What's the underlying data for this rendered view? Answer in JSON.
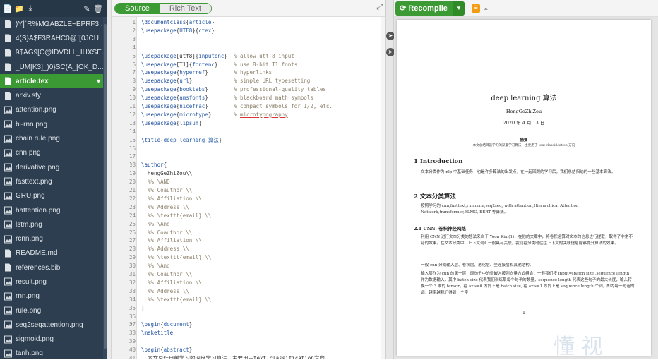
{
  "sidebar": {
    "files": [
      {
        "name": ")Y]`R%MGABZLE~EPRF3..."
      },
      {
        "name": "4(S}A$F3RAHC0@`[0JCU..."
      },
      {
        "name": "9$AG9[C@IDVDLL_IHXSE..."
      },
      {
        "name": "_UM[K3]_)0}SC(A_[OK_D..."
      },
      {
        "name": "article.tex",
        "active": true
      },
      {
        "name": "arxiv.sty"
      },
      {
        "name": "attention.png"
      },
      {
        "name": "bi-rnn.png"
      },
      {
        "name": "chain rule.png"
      },
      {
        "name": "cnn.png"
      },
      {
        "name": "derivative.png"
      },
      {
        "name": "fasttext.png"
      },
      {
        "name": "GRU.png"
      },
      {
        "name": "hattention.png"
      },
      {
        "name": "lstm.png"
      },
      {
        "name": "rcnn.png"
      },
      {
        "name": "README.md"
      },
      {
        "name": "references.bib"
      },
      {
        "name": "result.png"
      },
      {
        "name": "rnn.png"
      },
      {
        "name": "rule.png"
      },
      {
        "name": "seq2seqattention.png"
      },
      {
        "name": "sigmoid.png"
      },
      {
        "name": "tanh.png"
      }
    ]
  },
  "editor": {
    "toggle_source": "Source",
    "toggle_rich": "Rich Text",
    "lines": [
      {
        "n": "1",
        "t": "\\documentclass{article}"
      },
      {
        "n": "2",
        "t": "\\usepackage{UTF8}{ctex}"
      },
      {
        "n": "3",
        "t": ""
      },
      {
        "n": "4",
        "t": ""
      },
      {
        "n": "5",
        "t": "\\usepackage[utf8]{inputenc}  % allow utf-8 input"
      },
      {
        "n": "6",
        "t": "\\usepackage[T1]{fontenc}     % use 8-bit T1 fonts"
      },
      {
        "n": "7",
        "t": "\\usepackage{hyperref}        % hyperlinks"
      },
      {
        "n": "8",
        "t": "\\usepackage{url}             % simple URL typesetting"
      },
      {
        "n": "9",
        "t": "\\usepackage{booktabs}        % professional-quality tables"
      },
      {
        "n": "10",
        "t": "\\usepackage{amsfonts}        % blackboard math symbols"
      },
      {
        "n": "11",
        "t": "\\usepackage{nicefrac}        % compact symbols for 1/2, etc."
      },
      {
        "n": "12",
        "t": "\\usepackage{microtype}       % microtypography"
      },
      {
        "n": "13",
        "t": "\\usepackage{lipsum}"
      },
      {
        "n": "14",
        "t": ""
      },
      {
        "n": "15",
        "t": "\\title{deep learning 算法}"
      },
      {
        "n": "16",
        "t": ""
      },
      {
        "n": "17",
        "t": ""
      },
      {
        "n": "18",
        "t": "\\author{",
        "fold": true
      },
      {
        "n": "19",
        "t": "  HengGeZhiZou\\\\"
      },
      {
        "n": "20",
        "t": "  %% \\AND"
      },
      {
        "n": "21",
        "t": "  %% Coauthor \\\\"
      },
      {
        "n": "22",
        "t": "  %% Affiliation \\\\"
      },
      {
        "n": "23",
        "t": "  %% Address \\\\"
      },
      {
        "n": "24",
        "t": "  %% \\texttt{email} \\\\"
      },
      {
        "n": "25",
        "t": "  %% \\And"
      },
      {
        "n": "26",
        "t": "  %% Coauthor \\\\"
      },
      {
        "n": "27",
        "t": "  %% Affiliation \\\\"
      },
      {
        "n": "28",
        "t": "  %% Address \\\\"
      },
      {
        "n": "29",
        "t": "  %% \\texttt{email} \\\\"
      },
      {
        "n": "30",
        "t": "  %% \\And"
      },
      {
        "n": "31",
        "t": "  %% Coauthor \\\\"
      },
      {
        "n": "32",
        "t": "  %% Affiliation \\\\"
      },
      {
        "n": "33",
        "t": "  %% Address \\\\"
      },
      {
        "n": "34",
        "t": "  %% \\texttt{email} \\\\"
      },
      {
        "n": "35",
        "t": "}"
      },
      {
        "n": "36",
        "t": ""
      },
      {
        "n": "37",
        "t": "\\begin{document}",
        "fold": true
      },
      {
        "n": "38",
        "t": "\\maketitle"
      },
      {
        "n": "39",
        "t": ""
      },
      {
        "n": "40",
        "t": "\\begin{abstract}",
        "fold": true
      },
      {
        "n": "41",
        "t": "  本文总结目前学习的深度学习算法，主要用于text classification方向"
      }
    ]
  },
  "preview": {
    "recompile_label": "Recompile",
    "doc_title": "deep learning 算法",
    "doc_author": "HengGeZhiZou",
    "doc_date": "2020 年 4 月 13 日",
    "abstract_heading": "摘要",
    "abstract_text": "本文总结目前学习的深度学习算法，主要用于 text classification 方向",
    "sec1": "1    Introduction",
    "sec1_text": "文本分类作为 nlp 中基础任务，也是许多算法的出发点，在一起回顾的学习后，我们总结归纳的一些基本算法。",
    "sec2": "2    文本分类算法",
    "sec2_text": "按照学习的 cnn,fasttext,rnn,rcnn,seq2seq, with attention,Hierarchical Attention Network,transformer,ELMO, BERT 等算法。",
    "sec21": "2.1    CNN: 卷积神经网络",
    "sec21_p1": "利用 CNN 进行文本分类的想法来自于 Yoon Kim(1)，在他的文章中，将卷积运算对文本的信息进行提取，取得了非常不错的效果。在文本分类中，上下文词汇一般具有关联，我们在分类时往往上下文的关联信息能够提升算法的效果。",
    "sec21_p2": "一般 cnn 分成输入层、卷积层、池化层、全连接层和其他结构。",
    "sec21_p3": "输入层作为 cnn 的第一层，即句子中的词嵌入按列向量方式组合，一般我们按 input=[batch size ,sequence length] 作为数据输入，其中 batch size 代表我们训练集每个句子的数量，sequence length 代表这些句子的最大长度，输入转换一个 3 维的 tensor，在 axis=0 方向上是 batch size, 在 axis=1 方向上是 sequence length 个词，即为每一句话的词，越来越我们得到一个字",
    "page_number": "1",
    "watermark": "懂 视"
  }
}
